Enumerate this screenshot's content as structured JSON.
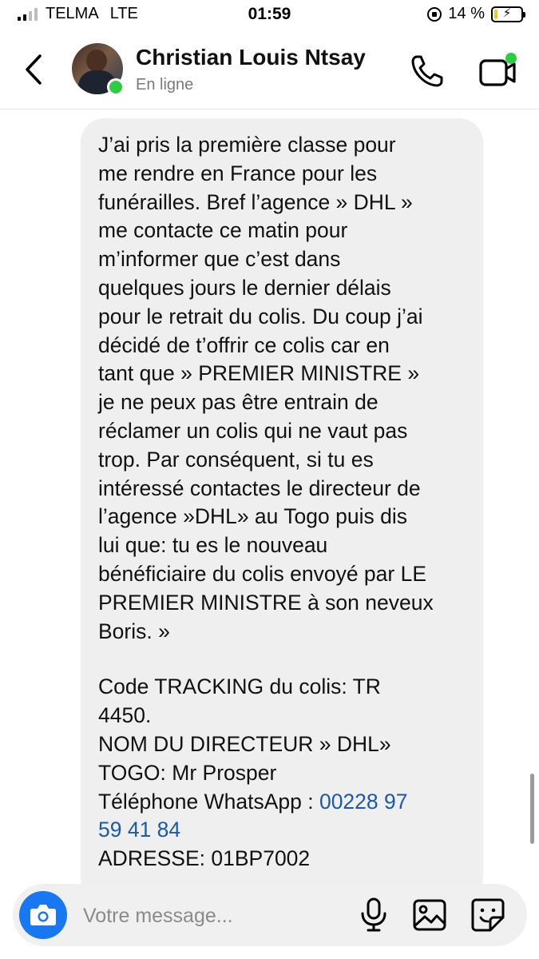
{
  "status_bar": {
    "carrier": "TELMA",
    "network": "LTE",
    "time": "01:59",
    "battery": "14 %",
    "battery_level": 0.14,
    "signal_bars": 2
  },
  "header": {
    "contact_name": "Christian Louis Ntsay",
    "presence": "En ligne",
    "icons": [
      "back-arrow-icon",
      "phone-icon",
      "video-camera-icon"
    ]
  },
  "message": {
    "paragraph1": "J’ai pris la première classe pour\nme rendre en France pour les\nfunérailles. Bref l’agence  » DHL »\nme contacte ce matin pour\nm’informer que c’est dans\nquelques jours le dernier délais\npour le retrait du colis. Du coup j’ai\ndécidé de t’offrir ce colis car en\ntant que  » PREMIER MINISTRE »\nje ne peux pas être entrain de\nréclamer un colis qui ne vaut pas\ntrop. Par conséquent, si tu es\nintéressé contactes le directeur de\nl’agence  »DHL» au Togo puis dis\nlui que: tu es le nouveau\nbénéficiaire du colis envoyé par LE\nPREMIER MINISTRE à son neveux\nBoris. »",
    "tracking": "Code TRACKING du colis: TR\n4450.",
    "director": "NOM DU DIRECTEUR  » DHL»\nTOGO: Mr Prosper",
    "phone_label": "Téléphone WhatsApp : ",
    "phone_number": "00228 97\n59 41 84",
    "address": "ADRESSE: 01BP7002"
  },
  "composer": {
    "placeholder": "Votre message...",
    "icons": [
      "camera-icon",
      "microphone-icon",
      "image-icon",
      "sticker-icon"
    ]
  },
  "colors": {
    "accent": "#1877f2",
    "online": "#2ecc40",
    "link": "#1a5aa8",
    "bubble": "#efefef"
  }
}
